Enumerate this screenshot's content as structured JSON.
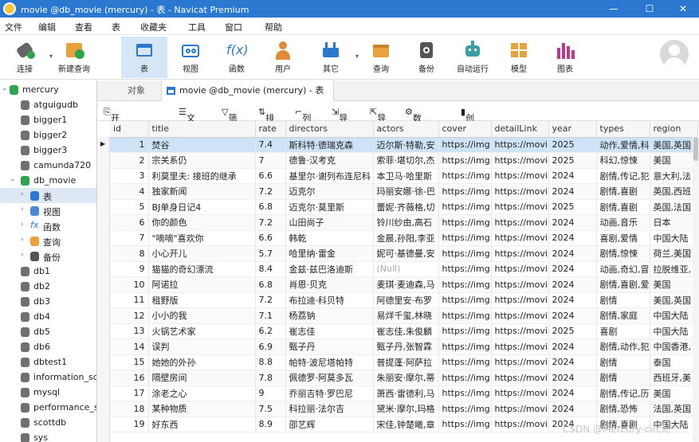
{
  "window": {
    "title": "movie @db_movie (mercury) - 表 - Navicat Premium"
  },
  "menu": [
    "文件",
    "编辑",
    "查看",
    "表",
    "收藏夹",
    "工具",
    "窗口",
    "帮助"
  ],
  "toolbar": [
    {
      "label": "连接",
      "icon": "connect-icon"
    },
    {
      "label": "新建查询",
      "icon": "new-query-icon"
    },
    {
      "label": "表",
      "icon": "table-icon"
    },
    {
      "label": "视图",
      "icon": "view-icon"
    },
    {
      "label": "函数",
      "icon": "function-icon"
    },
    {
      "label": "用户",
      "icon": "user-icon"
    },
    {
      "label": "其它",
      "icon": "other-icon"
    },
    {
      "label": "查询",
      "icon": "query-icon"
    },
    {
      "label": "备份",
      "icon": "backup-icon"
    },
    {
      "label": "自动运行",
      "icon": "robot-icon"
    },
    {
      "label": "模型",
      "icon": "model-icon"
    },
    {
      "label": "图表",
      "icon": "chart-icon"
    }
  ],
  "sidebar": {
    "connection": "mercury",
    "databases": [
      "atguigudb",
      "bigger1",
      "bigger2",
      "bigger3",
      "camunda720"
    ],
    "open_db": "db_movie",
    "children": [
      "表",
      "视图",
      "函数",
      "查询",
      "备份"
    ],
    "more_dbs": [
      "db1",
      "db2",
      "db3",
      "db4",
      "db5",
      "db6",
      "dbtest1",
      "information_sc",
      "mysql",
      "performance_s",
      "scottdb",
      "sys"
    ]
  },
  "tabs": [
    "对象",
    "movie @db_movie (mercury) - 表"
  ],
  "subtoolbar": [
    "开始事务",
    "文本 ▾",
    "筛选",
    "排序",
    "列",
    "导入",
    "导出",
    "数据生成",
    "创建图表"
  ],
  "columns": [
    "id",
    "title",
    "rate",
    "directors",
    "actors",
    "cover",
    "detailLink",
    "year",
    "types",
    "region"
  ],
  "rows": [
    [
      "1",
      "焚谷",
      "7.4",
      "斯科特·德瑞克森",
      "迈尔斯·特勒,安",
      "https://img",
      "https://movi",
      "2025",
      "动作,爱情,科",
      "美国,英国"
    ],
    [
      "2",
      "宗关系仍",
      "7",
      "德鲁·汉考克",
      "索菲·堪切尔,杰",
      "https://img",
      "https://movi",
      "2025",
      "科幻,惊悚",
      "美国"
    ],
    [
      "3",
      "利莫里夫: 接班的继承",
      "6.6",
      "基里尔·谢列布连尼科",
      "本卫马·哈里斯",
      "https://img",
      "https://movi",
      "2024",
      "剧情,传记,犯",
      "意大利,法"
    ],
    [
      "4",
      "独家新闻",
      "7.2",
      "迈克尔",
      "玛丽安娜·徐-巴",
      "https://img",
      "https://movi",
      "2024",
      "剧情,喜剧",
      "英国,西班"
    ],
    [
      "5",
      "BJ单身日记4",
      "6.8",
      "迈克尔·莫里斯",
      "蕾妮·齐薇格,切",
      "https://img",
      "https://movi",
      "2025",
      "剧情,喜剧",
      "英国,法国"
    ],
    [
      "6",
      "你的颜色",
      "7.2",
      "山田尚子",
      "铃川纱由,高石",
      "https://img",
      "https://movi",
      "2024",
      "动画,音乐",
      "日本"
    ],
    [
      "7",
      "\"嘀嘀\"喜欢你",
      "6.6",
      "韩乾",
      "金晨,孙阳,李亚",
      "https://img",
      "https://movi",
      "2024",
      "喜剧,爱情",
      "中国大陆"
    ],
    [
      "8",
      "小心开儿",
      "5.7",
      "哈里纳·雷金",
      "妮可·基德曼,安",
      "https://img",
      "https://movi",
      "2024",
      "剧情,惊悚",
      "荷兰,美国"
    ],
    [
      "9",
      "猫猫的奇幻漂流",
      "8.4",
      "金兹·兹巴洛迪斯",
      "(Null)",
      "https://img",
      "https://movi",
      "2024",
      "动画,奇幻,冒",
      "拉脱维亚,"
    ],
    [
      "10",
      "阿诺拉",
      "6.8",
      "肖恩·贝克",
      "麦琪·麦迪森,马",
      "https://img",
      "https://movi",
      "2024",
      "剧情,喜剧,爱",
      "美国"
    ],
    [
      "11",
      "租野版",
      "7.2",
      "布拉迪·科贝特",
      "阿德里安·布罗",
      "https://img",
      "https://movi",
      "2024",
      "剧情",
      "美国,英国"
    ],
    [
      "12",
      "小小的我",
      "7.1",
      "杨荔钠",
      "易烊千玺,林晓",
      "https://img",
      "https://movi",
      "2024",
      "剧情,家庭",
      "中国大陆"
    ],
    [
      "13",
      "火锅艺术家",
      "6.2",
      "崔志佳",
      "崔志佳,朱俊麟",
      "https://img",
      "https://movi",
      "2025",
      "喜剧",
      "中国大陆"
    ],
    [
      "14",
      "误判",
      "6.9",
      "甄子丹",
      "甄子丹,张智霖",
      "https://img",
      "https://movi",
      "2024",
      "剧情,动作,犯",
      "中国香港,"
    ],
    [
      "15",
      "她她的外孙",
      "8.8",
      "帕特·波尼塔帕特",
      "普提蓬·阿萨拉",
      "https://img",
      "https://movi",
      "2024",
      "剧情",
      "泰国"
    ],
    [
      "16",
      "隔壁房间",
      "7.8",
      "佩德罗·阿莫多瓦",
      "朱丽安·摩尔,蒂",
      "https://img",
      "https://movi",
      "2024",
      "剧情",
      "西班牙,美"
    ],
    [
      "17",
      "涂老之心",
      "9",
      "乔丽吉特·罗巴尼",
      "萧西·雷德利,马",
      "https://img",
      "https://movi",
      "2024",
      "剧情,传记,历",
      "美国"
    ],
    [
      "18",
      "某种物质",
      "7.5",
      "科拉丽·法尔吉",
      "黛米·摩尔,玛格",
      "https://img",
      "https://movi",
      "2024",
      "剧情,恐怖",
      "法国,英国"
    ],
    [
      "19",
      "好东西",
      "8.9",
      "邵艺辉",
      "宋佳,钟楚曦,章",
      "https://img",
      "https://movi",
      "2024",
      "剧情,喜剧",
      "中国大陆"
    ]
  ],
  "watermark": "CSDN @Mercury-circle",
  "colors": {
    "titlebar": "#2b78d0",
    "selection": "#cfe3f7",
    "active_tool": "#d6e6f7"
  }
}
